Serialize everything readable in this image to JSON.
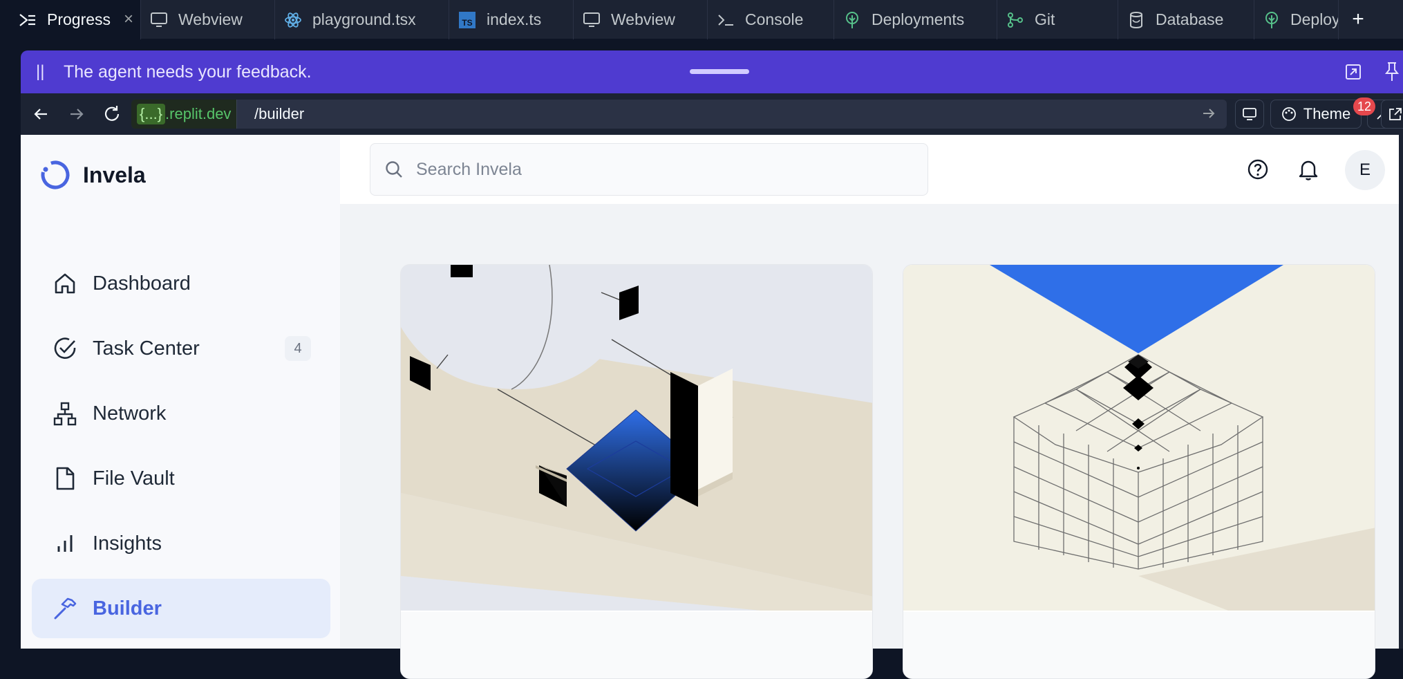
{
  "tabs": [
    {
      "label": "Progress",
      "icon": "progress-icon",
      "active": true,
      "closable": true
    },
    {
      "label": "Webview",
      "icon": "monitor-icon"
    },
    {
      "label": "playground.tsx",
      "icon": "react-icon"
    },
    {
      "label": "index.ts",
      "icon": "typescript-icon",
      "icon_text": "TS"
    },
    {
      "label": "Webview",
      "icon": "monitor-icon"
    },
    {
      "label": "Console",
      "icon": "terminal-icon"
    },
    {
      "label": "Deployments",
      "icon": "deployments-icon"
    },
    {
      "label": "Git",
      "icon": "git-icon"
    },
    {
      "label": "Database",
      "icon": "database-icon"
    },
    {
      "label": "Deploy",
      "icon": "deployments-icon"
    }
  ],
  "tab_add": "+",
  "tab_close": "×",
  "banner": {
    "pause_icon": "||",
    "message": "The agent needs your feedback."
  },
  "urlbar": {
    "host_template": "{...}",
    "host_domain": ".replit.dev",
    "path": "/builder",
    "theme_label": "Theme",
    "badge_count": "12"
  },
  "app": {
    "name": "Invela",
    "search_placeholder": "Search Invela",
    "avatar_initial": "E",
    "brand_color": "#4965e0"
  },
  "sidebar": {
    "items": [
      {
        "label": "Dashboard",
        "icon": "home-icon"
      },
      {
        "label": "Task Center",
        "icon": "check-circle-icon",
        "count": "4"
      },
      {
        "label": "Network",
        "icon": "network-icon"
      },
      {
        "label": "File Vault",
        "icon": "file-icon"
      },
      {
        "label": "Insights",
        "icon": "bar-chart-icon"
      },
      {
        "label": "Builder",
        "icon": "hammer-icon",
        "active": true
      }
    ]
  }
}
